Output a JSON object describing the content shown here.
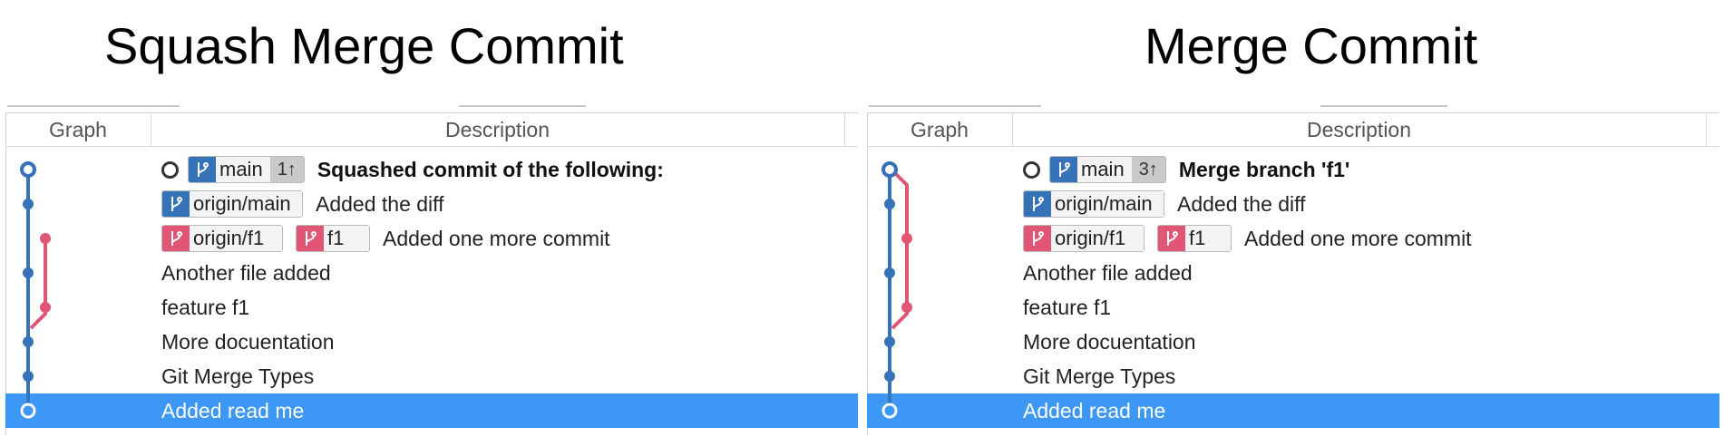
{
  "panels": [
    {
      "title": "Squash Merge Commit",
      "columns": {
        "graph": "Graph",
        "description": "Description"
      },
      "head": {
        "branch": "main",
        "ahead": "1↑",
        "message": "Squashed commit of the following:"
      },
      "rows": [
        {
          "refs": [
            {
              "name": "origin/main",
              "color": "#3672b8"
            }
          ],
          "message": "Added the diff"
        },
        {
          "refs": [
            {
              "name": "origin/f1",
              "color": "#e15575"
            },
            {
              "name": "f1",
              "color": "#e15575"
            }
          ],
          "message": "Added one more commit"
        },
        {
          "message": "Another file added"
        },
        {
          "message": "feature f1"
        },
        {
          "message": "More docuentation"
        },
        {
          "message": "Git Merge Types"
        },
        {
          "message": "Added read me",
          "selected": true
        }
      ]
    },
    {
      "title": "Merge Commit",
      "columns": {
        "graph": "Graph",
        "description": "Description"
      },
      "head": {
        "branch": "main",
        "ahead": "3↑",
        "message": "Merge branch 'f1'"
      },
      "rows": [
        {
          "refs": [
            {
              "name": "origin/main",
              "color": "#3672b8"
            }
          ],
          "message": "Added the diff"
        },
        {
          "refs": [
            {
              "name": "origin/f1",
              "color": "#e15575"
            },
            {
              "name": "f1",
              "color": "#e15575"
            }
          ],
          "message": "Added one more commit"
        },
        {
          "message": "Another file added"
        },
        {
          "message": "feature f1"
        },
        {
          "message": "More docuentation"
        },
        {
          "message": "Git Merge Types"
        },
        {
          "message": "Added read me",
          "selected": true
        }
      ]
    }
  ],
  "colors": {
    "main_branch": "#3672b8",
    "feature_branch": "#e15575",
    "selection": "#3d98f5"
  },
  "icons": {
    "branch": "git-branch-icon",
    "head": "head-marker-icon"
  }
}
